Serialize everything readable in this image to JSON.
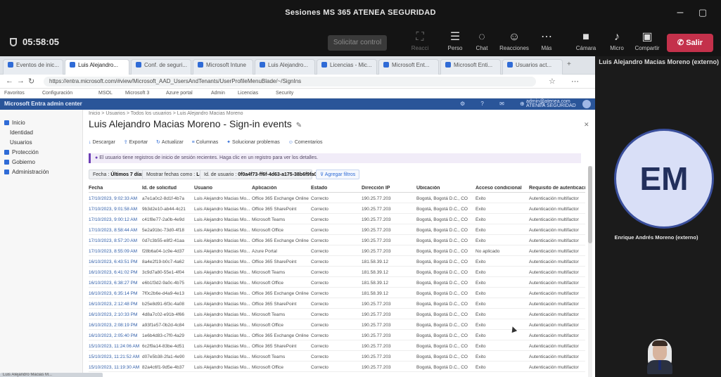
{
  "window": {
    "title": "Sesiones MS 365 ATENEA SEGURIDAD",
    "minimize_icon": "minimize-icon",
    "maximize_icon": "maximize-icon",
    "close_icon": "close-icon"
  },
  "meeting_toolbar": {
    "timer": "05:58:05",
    "request_control": "Solicitar control",
    "buttons": [
      {
        "id": "dim",
        "icon": "people-add-icon",
        "label": "Reacci"
      },
      {
        "id": "people",
        "icon": "people-icon",
        "label": "Perso"
      },
      {
        "id": "chat",
        "icon": "chat-icon",
        "label": "Chat"
      },
      {
        "id": "reactions",
        "icon": "reactions-icon",
        "label": "Reacciones"
      },
      {
        "id": "more",
        "icon": "more-icon",
        "label": "Más"
      },
      {
        "id": "camera",
        "icon": "camera-icon",
        "label": "Cámara"
      },
      {
        "id": "mic",
        "icon": "mic-icon",
        "label": "Micro"
      },
      {
        "id": "share",
        "icon": "share-icon",
        "label": "Compartir"
      }
    ],
    "leave": "Salir"
  },
  "browser": {
    "tabs": [
      "Eventos de inic...",
      "Luis Alejandro...",
      "Conf. de seguri...",
      "Microsoft Intune",
      "Luis Alejandro...",
      "Licencias - Mic...",
      "Microsoft Ent...",
      "Microsoft Enti...",
      "Usuarios act..."
    ],
    "url": "https://entra.microsoft.com/#view/Microsoft_AAD_UsersAndTenants/UserProfileMenuBlade/~/SignIns",
    "bookmarks": [
      "Favoritos",
      "Configuración",
      "MSOL",
      "Microsoft 3",
      "Azure portal",
      "Admin",
      "Licencias",
      "Security"
    ]
  },
  "app": {
    "name": "Microsoft Entra admin center",
    "icons": "⚙ ? ✉ ⊕ ☺",
    "user": "admin@atenea.com ATENEA SEGURIDAD"
  },
  "sitemap": [
    {
      "label": "Inicio",
      "color": "#2f6bd6"
    },
    {
      "label": "Identidad",
      "color": "#7a7a7a"
    },
    {
      "label": "Usuarios",
      "color": "#7a7a7a"
    },
    {
      "label": "Protección",
      "color": "#2f6bd6"
    },
    {
      "label": "Gobierno",
      "color": "#2f6bd6"
    },
    {
      "label": "Administración",
      "color": "#2f6bd6"
    }
  ],
  "content": {
    "breadcrumb": "Inicio > Usuarios > Todos los usuarios > Luis Alejandro Macias Moreno",
    "title": "Luis Alejandro Macias Moreno - Sign-in events",
    "commands": [
      "Descargar",
      "Exportar",
      "Actualizar",
      "Columnas",
      "Solucionar problemas",
      "Comentarios"
    ],
    "notice": "El usuario tiene registros de inicio de sesión recientes. Haga clic en un registro para ver los detalles.",
    "filters": [
      {
        "label": "Fecha :",
        "value": "Últimos 7 días"
      },
      {
        "label": "Mostrar fechas como :",
        "value": "Local"
      },
      {
        "label": "Id. de usuario :",
        "value": "0f0a4f73-ff6f-4d63-a175-38b6f9fa0f3e"
      }
    ],
    "add_filter": "Agregar filtros",
    "columns": [
      "Fecha",
      "Id. de solicitud",
      "Usuario",
      "Aplicación",
      "Estado",
      "Dirección IP",
      "Ubicación",
      "Acceso condicional",
      "Requisito de autenticación"
    ],
    "rows": [
      [
        "17/10/2023, 9:02:33 AM",
        "a7e1a0c2-8d1f-4b7a",
        "Luis Alejandro Macias Mo...",
        "Office 365 Exchange Online",
        "Correcto",
        "190.25.77.203",
        "Bogotá, Bogotá D.C., CO",
        "Éxito",
        "Autenticación multifactor"
      ],
      [
        "17/10/2023, 9:01:58 AM",
        "9b3d2e10-ab44-4c21",
        "Luis Alejandro Macias Mo...",
        "Office 365 SharePoint",
        "Correcto",
        "190.25.77.203",
        "Bogotá, Bogotá D.C., CO",
        "Éxito",
        "Autenticación multifactor"
      ],
      [
        "17/10/2023, 9:00:12 AM",
        "c41f8e77-2a0b-4e9d",
        "Luis Alejandro Macias Mo...",
        "Microsoft Teams",
        "Correcto",
        "190.25.77.203",
        "Bogotá, Bogotá D.C., CO",
        "Éxito",
        "Autenticación multifactor"
      ],
      [
        "17/10/2023, 8:58:44 AM",
        "5e2a91bc-73d0-4f18",
        "Luis Alejandro Macias Mo...",
        "Microsoft Office",
        "Correcto",
        "190.25.77.203",
        "Bogotá, Bogotá D.C., CO",
        "Éxito",
        "Autenticación multifactor"
      ],
      [
        "17/10/2023, 8:57:20 AM",
        "0d7c3b55-e8f2-41aa",
        "Luis Alejandro Macias Mo...",
        "Office 365 Exchange Online",
        "Correcto",
        "190.25.77.203",
        "Bogotá, Bogotá D.C., CO",
        "Éxito",
        "Autenticación multifactor"
      ],
      [
        "17/10/2023, 8:55:09 AM",
        "f28b6a04-1c9e-4d37",
        "Luis Alejandro Macias Mo...",
        "Azure Portal",
        "Correcto",
        "190.25.77.203",
        "Bogotá, Bogotá D.C., CO",
        "No aplicado",
        "Autenticación multifactor"
      ],
      [
        "16/10/2023, 6:43:51 PM",
        "8a4e2f19-b0c7-4a62",
        "Luis Alejandro Macias Mo...",
        "Office 365 SharePoint",
        "Correcto",
        "181.58.39.12",
        "Bogotá, Bogotá D.C., CO",
        "Éxito",
        "Autenticación multifactor"
      ],
      [
        "16/10/2023, 6:41:02 PM",
        "3c9d7a80-55e1-4f04",
        "Luis Alejandro Macias Mo...",
        "Microsoft Teams",
        "Correcto",
        "181.58.39.12",
        "Bogotá, Bogotá D.C., CO",
        "Éxito",
        "Autenticación multifactor"
      ],
      [
        "16/10/2023, 6:38:27 PM",
        "e6b1f3d2-9a0c-4b75",
        "Luis Alejandro Macias Mo...",
        "Microsoft Office",
        "Correcto",
        "181.58.39.12",
        "Bogotá, Bogotá D.C., CO",
        "Éxito",
        "Autenticación multifactor"
      ],
      [
        "16/10/2023, 6:35:14 PM",
        "7f0c2b6e-d4a9-4e13",
        "Luis Alejandro Macias Mo...",
        "Office 365 Exchange Online",
        "Correcto",
        "181.58.39.12",
        "Bogotá, Bogotá D.C., CO",
        "Éxito",
        "Autenticación multifactor"
      ],
      [
        "16/10/2023, 2:12:48 PM",
        "b25e8d91-6f3c-4a08",
        "Luis Alejandro Macias Mo...",
        "Office 365 SharePoint",
        "Correcto",
        "190.25.77.203",
        "Bogotá, Bogotá D.C., CO",
        "Éxito",
        "Autenticación multifactor"
      ],
      [
        "16/10/2023, 2:10:33 PM",
        "4d8a7c02-e91b-4f66",
        "Luis Alejandro Macias Mo...",
        "Microsoft Teams",
        "Correcto",
        "190.25.77.203",
        "Bogotá, Bogotá D.C., CO",
        "Éxito",
        "Autenticación multifactor"
      ],
      [
        "16/10/2023, 2:08:19 PM",
        "a93f1e57-0b2d-4c84",
        "Luis Alejandro Macias Mo...",
        "Microsoft Office",
        "Correcto",
        "190.25.77.203",
        "Bogotá, Bogotá D.C., CO",
        "Éxito",
        "Autenticación multifactor"
      ],
      [
        "16/10/2023, 2:05:40 PM",
        "1e6b4d83-c7f0-4a29",
        "Luis Alejandro Macias Mo...",
        "Office 365 Exchange Online",
        "Correcto",
        "190.25.77.203",
        "Bogotá, Bogotá D.C., CO",
        "Éxito",
        "Autenticación multifactor"
      ],
      [
        "15/10/2023, 11:24:06 AM",
        "6c2f9a14-83be-4d51",
        "Luis Alejandro Macias Mo...",
        "Office 365 SharePoint",
        "Correcto",
        "190.25.77.203",
        "Bogotá, Bogotá D.C., CO",
        "Éxito",
        "Autenticación multifactor"
      ],
      [
        "15/10/2023, 11:21:52 AM",
        "d07e5b38-2fa1-4e90",
        "Luis Alejandro Macias Mo...",
        "Microsoft Teams",
        "Correcto",
        "190.25.77.203",
        "Bogotá, Bogotá D.C., CO",
        "Éxito",
        "Autenticación multifactor"
      ],
      [
        "15/10/2023, 11:19:30 AM",
        "82a4c6f1-9d5e-4b37",
        "Luis Alejandro Macias Mo...",
        "Microsoft Office",
        "Correcto",
        "190.25.77.203",
        "Bogotá, Bogotá D.C., CO",
        "Éxito",
        "Autenticación multifactor"
      ]
    ],
    "bottom_strip": "Luis Alejandro Macias M..."
  },
  "participants": {
    "sharer_label": "Luis Alejandro Macias Moreno (externo)",
    "avatar_initials": "EM",
    "tile_name": "Enrique Andrés Moreno (externo)"
  }
}
